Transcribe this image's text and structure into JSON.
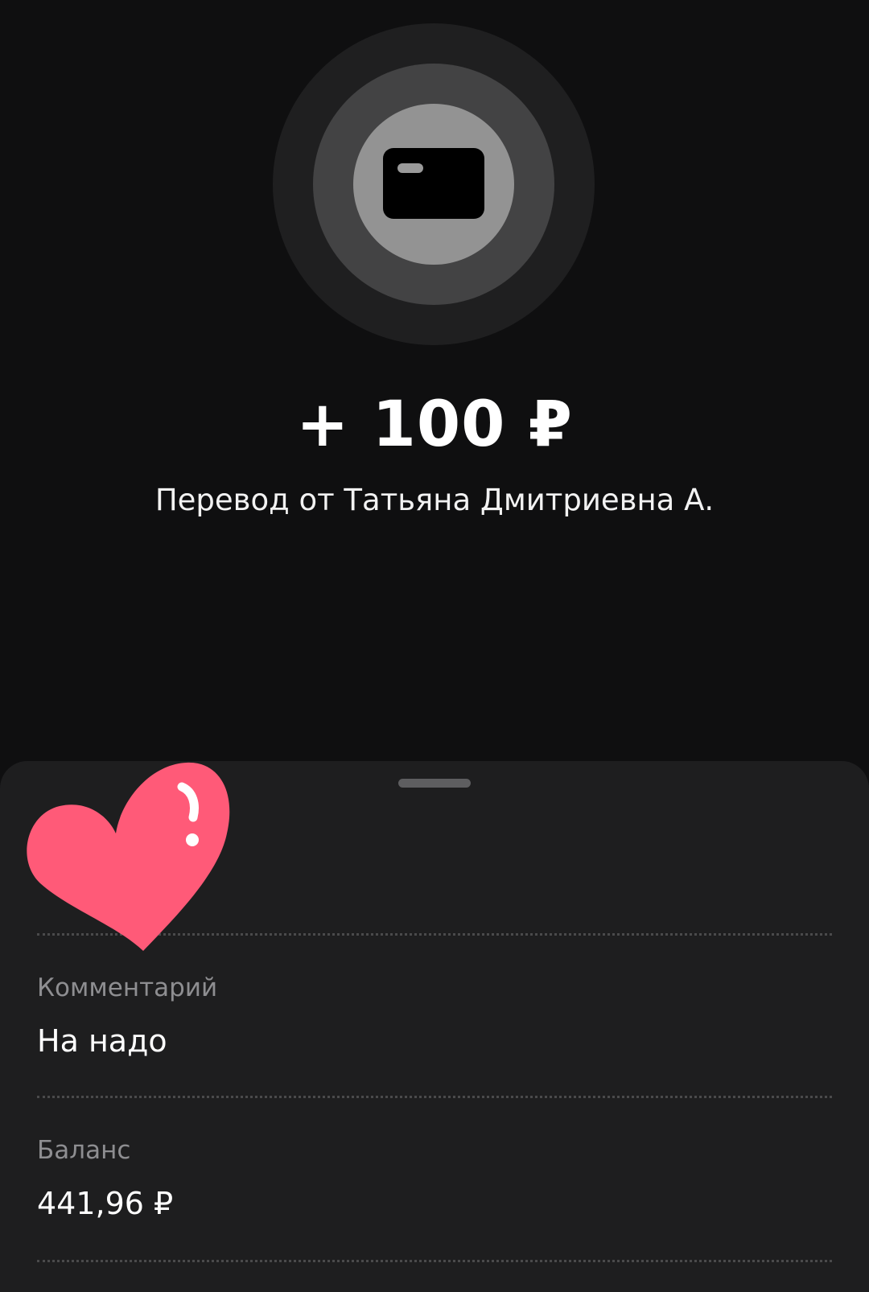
{
  "transaction": {
    "amount": "+ 100 ₽",
    "description": "Перевод от Татьяна Дмитриевна А."
  },
  "details": {
    "comment_label": "Комментарий",
    "comment_value": "На надо",
    "balance_label": "Баланс",
    "balance_value": "441,96 ₽"
  },
  "icons": {
    "hero": "card-icon",
    "sticker": "heart-sticker-icon"
  },
  "colors": {
    "background": "#0f0f10",
    "sheet": "#1e1e1f",
    "heart": "#ff5a78",
    "label": "#8e8e91"
  }
}
